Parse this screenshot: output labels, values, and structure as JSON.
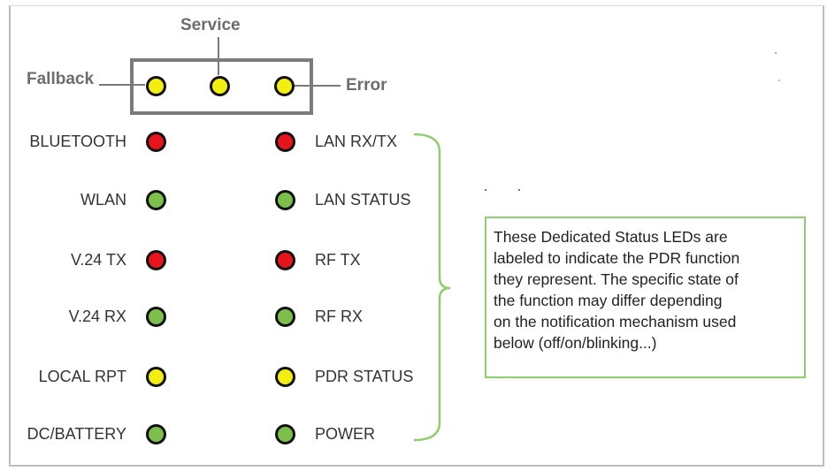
{
  "top_leds": {
    "fallback_label": "Fallback",
    "service_label": "Service",
    "error_label": "Error",
    "color": "yellow"
  },
  "status_rows": [
    {
      "left_label": "BLUETOOTH",
      "left_color": "red",
      "right_label": "LAN RX/TX",
      "right_color": "red"
    },
    {
      "left_label": "WLAN",
      "left_color": "green",
      "right_label": "LAN STATUS",
      "right_color": "green"
    },
    {
      "left_label": "V.24 TX",
      "left_color": "red",
      "right_label": "RF TX",
      "right_color": "red"
    },
    {
      "left_label": "V.24 RX",
      "left_color": "green",
      "right_label": "RF RX",
      "right_color": "green"
    },
    {
      "left_label": "LOCAL RPT",
      "left_color": "yellow",
      "right_label": "PDR STATUS",
      "right_color": "yellow"
    },
    {
      "left_label": "DC/BATTERY",
      "left_color": "green",
      "right_label": "POWER",
      "right_color": "green"
    }
  ],
  "note": {
    "lines": [
      "These Dedicated Status LEDs are",
      "labeled to indicate the PDR function",
      "they represent.  The specific state of",
      "the function may differ depending",
      "on the notification mechanism used",
      "below (off/on/blinking...)"
    ]
  },
  "colors": {
    "red": "#e8141c",
    "green": "#7dbf4b",
    "yellow": "#f2ef10",
    "brace": "#8fce6f",
    "box_border": "#7b7b7b"
  }
}
